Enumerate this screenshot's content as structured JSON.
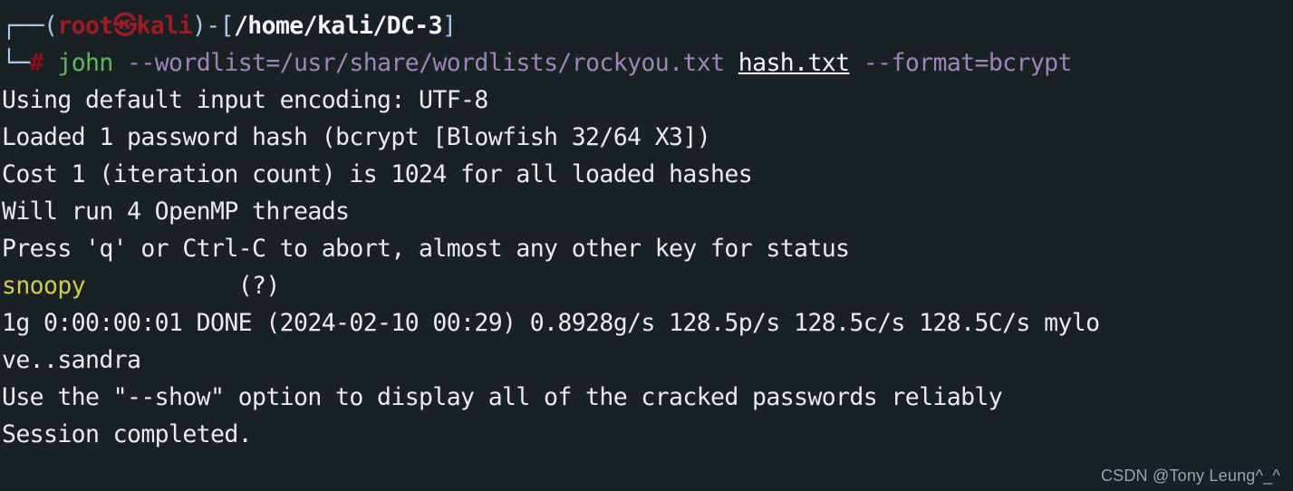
{
  "terminal": {
    "background_color": "#1a2125",
    "foreground_color": "#e8eaed",
    "prompt": {
      "frame_top": "┌──(",
      "user": "root",
      "kali_glyph": "㉿",
      "host": "kali",
      "close_paren": ")-[",
      "path": "/home/kali/DC-3",
      "close_bracket": "]",
      "frame_bottom": "└─",
      "sigil": "#"
    },
    "command": {
      "name": "john",
      "wordlist_flag": "--wordlist=/usr/share/wordlists/rockyou.txt",
      "hash_file": "hash.txt",
      "format_flag": "--format=bcrypt"
    },
    "output_lines": [
      "Using default input encoding: UTF-8",
      "Loaded 1 password hash (bcrypt [Blowfish 32/64 X3])",
      "Cost 1 (iteration count) is 1024 for all loaded hashes",
      "Will run 4 OpenMP threads",
      "Press 'q' or Ctrl-C to abort, almost any other key for status"
    ],
    "cracked": {
      "password": "snoopy",
      "gap": "           ",
      "login": "(?)"
    },
    "status": {
      "line_part1": "1g 0:00:00:01 DONE (2024-02-10 00:29) 0.8928g/s 128.5p/s 128.5c/s 128.5C/s mylo",
      "line_part2": "ve..sandra",
      "guesses": "1g",
      "elapsed": "0:00:00:01",
      "state": "DONE",
      "timestamp": "2024-02-10 00:29",
      "gps": "0.8928g/s",
      "pps": "128.5p/s",
      "cps": "128.5c/s",
      "CPS": "128.5C/s",
      "candidates": "mylove..sandra"
    },
    "footer_lines": [
      "Use the \"--show\" option to display all of the cracked passwords reliably",
      "Session completed."
    ]
  },
  "watermark": {
    "text": "CSDN @Tony Leung^_^"
  }
}
